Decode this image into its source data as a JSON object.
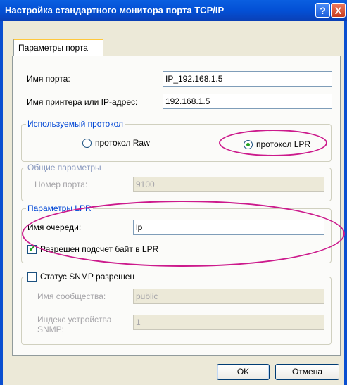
{
  "window": {
    "title": "Настройка стандартного монитора порта TCP/IP",
    "help_label": "?",
    "close_label": "X"
  },
  "tab": {
    "label": "Параметры порта"
  },
  "port_name": {
    "label": "Имя порта:",
    "value": "IP_192.168.1.5"
  },
  "printer_address": {
    "label": "Имя принтера или IP-адрес:",
    "value": "192.168.1.5"
  },
  "protocol_group": {
    "title": "Используемый протокол",
    "raw_label": "протокол Raw",
    "lpr_label": "протокол LPR",
    "selected": "LPR"
  },
  "general_group": {
    "title": "Общие параметры",
    "port_number_label": "Номер порта:",
    "port_number_value": "9100"
  },
  "lpr_group": {
    "title": "Параметры LPR",
    "queue_label": "Имя очереди:",
    "queue_value": "lp",
    "byte_count_label": "Разрешен подсчет байт в LPR",
    "byte_count_checked": true
  },
  "snmp_group": {
    "title": "Статус SNMP разрешен",
    "enabled": false,
    "community_label": "Имя сообщества:",
    "community_value": "public",
    "device_index_label": "Индекс устройства SNMP:",
    "device_index_value": "1"
  },
  "buttons": {
    "ok": "OK",
    "cancel": "Отмена"
  },
  "colors": {
    "title_bar": "#0350d5",
    "group_title": "#0046d5",
    "annotation": "#cc1a8c"
  }
}
